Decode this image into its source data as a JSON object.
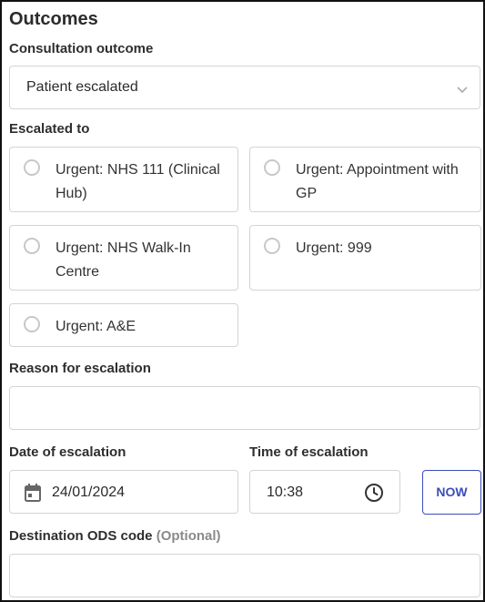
{
  "section": {
    "title": "Outcomes"
  },
  "consultation": {
    "label": "Consultation outcome",
    "value": "Patient escalated"
  },
  "escalated_to": {
    "label": "Escalated to",
    "options": [
      {
        "label": "Urgent: NHS 111 (Clinical Hub)",
        "selected": false
      },
      {
        "label": "Urgent: Appointment with GP",
        "selected": false
      },
      {
        "label": "Urgent: NHS Walk-In Centre",
        "selected": false
      },
      {
        "label": "Urgent: 999",
        "selected": false
      },
      {
        "label": "Urgent: A&E",
        "selected": false
      }
    ]
  },
  "reason": {
    "label": "Reason for escalation",
    "value": ""
  },
  "date": {
    "label": "Date of escalation",
    "value": "24/01/2024"
  },
  "time": {
    "label": "Time of escalation",
    "value": "10:38",
    "now_label": "NOW"
  },
  "ods": {
    "label": "Destination ODS code",
    "optional_label": "(Optional)",
    "value": ""
  },
  "colors": {
    "accent": "#3d4db7",
    "border": "#d4d4d4",
    "radio": "#c8c8c8"
  }
}
